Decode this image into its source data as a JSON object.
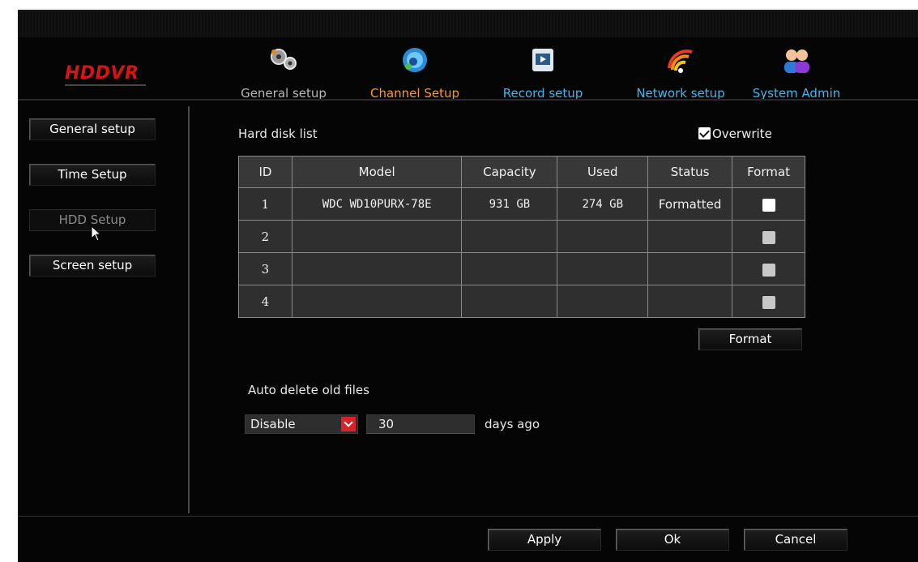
{
  "app": {
    "logo": "HDDVR"
  },
  "topnav": {
    "tabs": [
      {
        "label": "General setup",
        "icon": "gears-icon",
        "color": "#b8b8b8"
      },
      {
        "label": "Channel Setup",
        "icon": "camera-icon",
        "color": "#ff9a1a"
      },
      {
        "label": "Record setup",
        "icon": "film-icon",
        "color": "#3fb7f0"
      },
      {
        "label": "Network setup",
        "icon": "wifi-icon",
        "color": "#3fb7f0"
      },
      {
        "label": "System Admin",
        "icon": "users-icon",
        "color": "#3fb7f0"
      }
    ]
  },
  "sidebar": {
    "items": [
      {
        "label": "General setup",
        "active": false
      },
      {
        "label": "Time Setup",
        "active": false
      },
      {
        "label": "HDD Setup",
        "active": true
      },
      {
        "label": "Screen setup",
        "active": false
      }
    ]
  },
  "main": {
    "hdd_list_label": "Hard disk list",
    "overwrite_label": "Overwrite",
    "overwrite_checked": true,
    "table": {
      "headers": [
        "ID",
        "Model",
        "Capacity",
        "Used",
        "Status",
        "Format"
      ],
      "rows": [
        {
          "id": "1",
          "model": "WDC WD10PURX-78E",
          "capacity": "931 GB",
          "used": "274 GB",
          "status": "Formatted"
        },
        {
          "id": "2",
          "model": "",
          "capacity": "",
          "used": "",
          "status": ""
        },
        {
          "id": "3",
          "model": "",
          "capacity": "",
          "used": "",
          "status": ""
        },
        {
          "id": "4",
          "model": "",
          "capacity": "",
          "used": "",
          "status": ""
        }
      ]
    },
    "format_button": "Format",
    "auto_delete_label": "Auto delete old files",
    "auto_delete_select": "Disable",
    "days_value": "30",
    "days_suffix": "days ago"
  },
  "footer": {
    "apply": "Apply",
    "ok": "Ok",
    "cancel": "Cancel"
  },
  "colors": {
    "logo": "#d61414",
    "active_tab": "#ff9a1a",
    "tab_link": "#3fb7f0",
    "select_arrow": "#d8232a"
  }
}
